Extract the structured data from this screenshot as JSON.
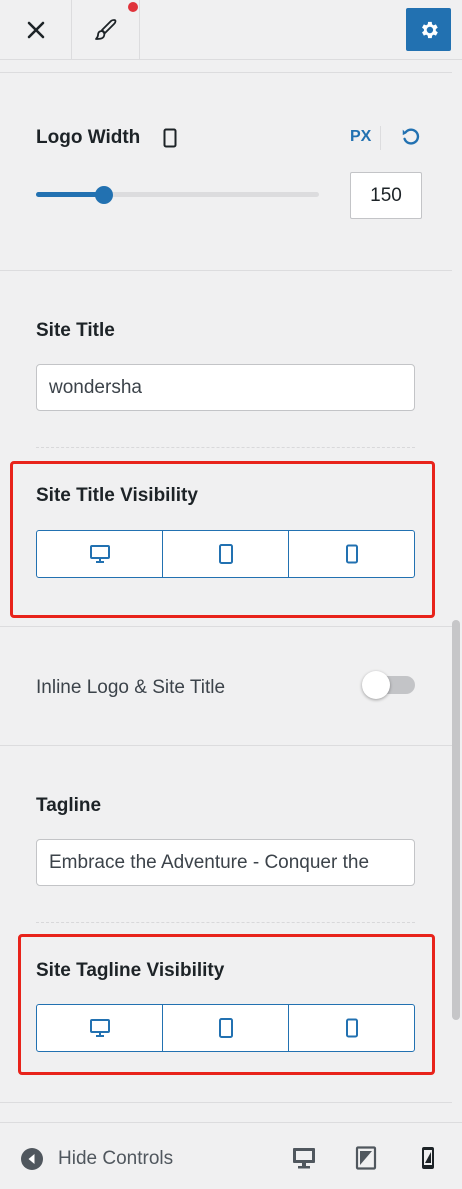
{
  "header": {
    "close_icon": "close-icon",
    "styles_icon": "brush-icon",
    "settings_icon": "gear-icon"
  },
  "logo_width": {
    "label": "Logo Width",
    "unit": "PX",
    "value": "150",
    "slider_fraction": 0.24
  },
  "site_title": {
    "label": "Site Title",
    "value": "wondersha"
  },
  "site_title_visibility": {
    "label": "Site Title Visibility",
    "options": [
      "desktop-icon",
      "tablet-icon",
      "mobile-icon"
    ]
  },
  "inline_logo": {
    "label": "Inline Logo & Site Title",
    "enabled": false
  },
  "tagline": {
    "label": "Tagline",
    "value": "Embrace the Adventure - Conquer the"
  },
  "site_tagline_visibility": {
    "label": "Site Tagline Visibility",
    "options": [
      "desktop-icon",
      "tablet-icon",
      "mobile-icon"
    ]
  },
  "footer": {
    "hide_label": "Hide Controls",
    "active_device": "mobile"
  },
  "colors": {
    "accent": "#2271b1",
    "highlight": "#e8231b",
    "background": "#f0f0f1"
  }
}
